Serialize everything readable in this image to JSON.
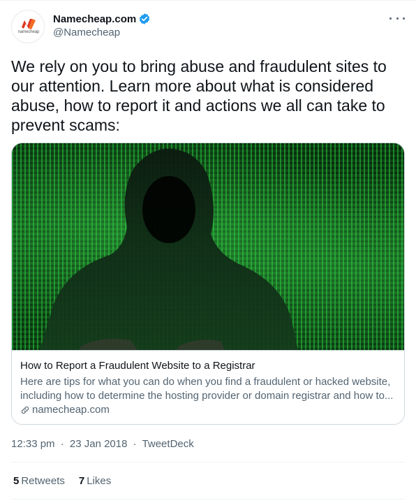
{
  "author": {
    "display_name": "Namecheap.com",
    "handle": "@Namecheap",
    "avatar_word": "namecheap",
    "verified": true,
    "avatar_icon": "namecheap-logo",
    "brand_color": "#de3723"
  },
  "tweet": {
    "text": "We rely on you to bring abuse and fraudulent sites to our attention. Learn more about what is considered abuse, how to report it and actions we all can take to prevent scams:"
  },
  "card": {
    "image_alt": "hooded-figure-matrix-image",
    "title": "How to Report a Fraudulent Website to a Registrar",
    "description": "Here are tips for what you can do when you find a fraudulent or hacked website, including how to determine the hosting provider or domain registrar and how to...",
    "domain": "namecheap.com"
  },
  "meta": {
    "time": "12:33 pm",
    "date": "23 Jan 2018",
    "separator": "·",
    "source": "TweetDeck"
  },
  "stats": {
    "retweets_count": "5",
    "retweets_label": "Retweets",
    "likes_count": "7",
    "likes_label": "Likes"
  },
  "colors": {
    "verified_blue": "#1d9bf0",
    "secondary_text": "#536471",
    "matrix_green": "#28c83c"
  }
}
